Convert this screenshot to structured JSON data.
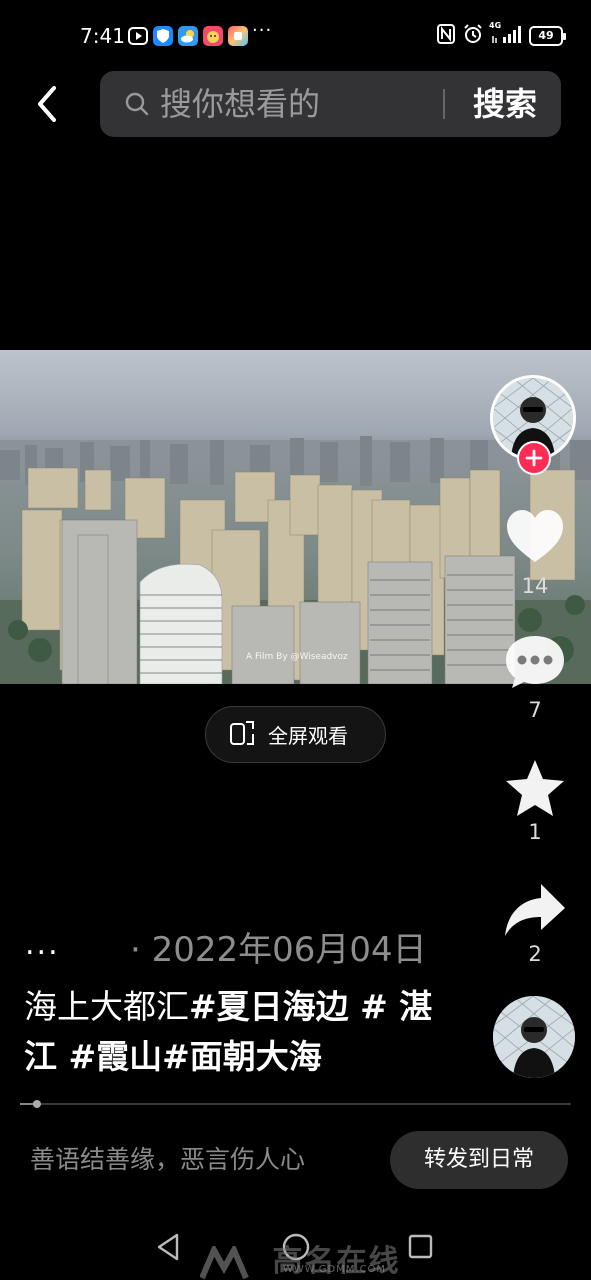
{
  "status_bar": {
    "time": "7:41",
    "more": "···",
    "network": "4G",
    "battery": "49"
  },
  "search": {
    "placeholder": "搜你想看的",
    "button_label": "搜索"
  },
  "video": {
    "watermark": "A Film By @Wiseadvoz",
    "fullscreen_label": "全屏观看"
  },
  "actions": {
    "likes": "14",
    "comments": "7",
    "favorites": "1",
    "shares": "2"
  },
  "post": {
    "more": "...",
    "date": "· 2022年06月04日",
    "caption_plain": "海上大都汇",
    "caption_tags": "#夏日海边 # 湛江 #霞山#面朝大海"
  },
  "progress": 0.03,
  "comment_bar": {
    "placeholder": "善语结善缘，恶言伤人心",
    "share_daily_label": "转发到日常"
  },
  "nav_watermark": {
    "brand": "高名在线",
    "url": "WWW.GDMM.COM"
  },
  "colors": {
    "accent": "#fe2c55",
    "background": "#000000",
    "search_bg": "#333336"
  }
}
